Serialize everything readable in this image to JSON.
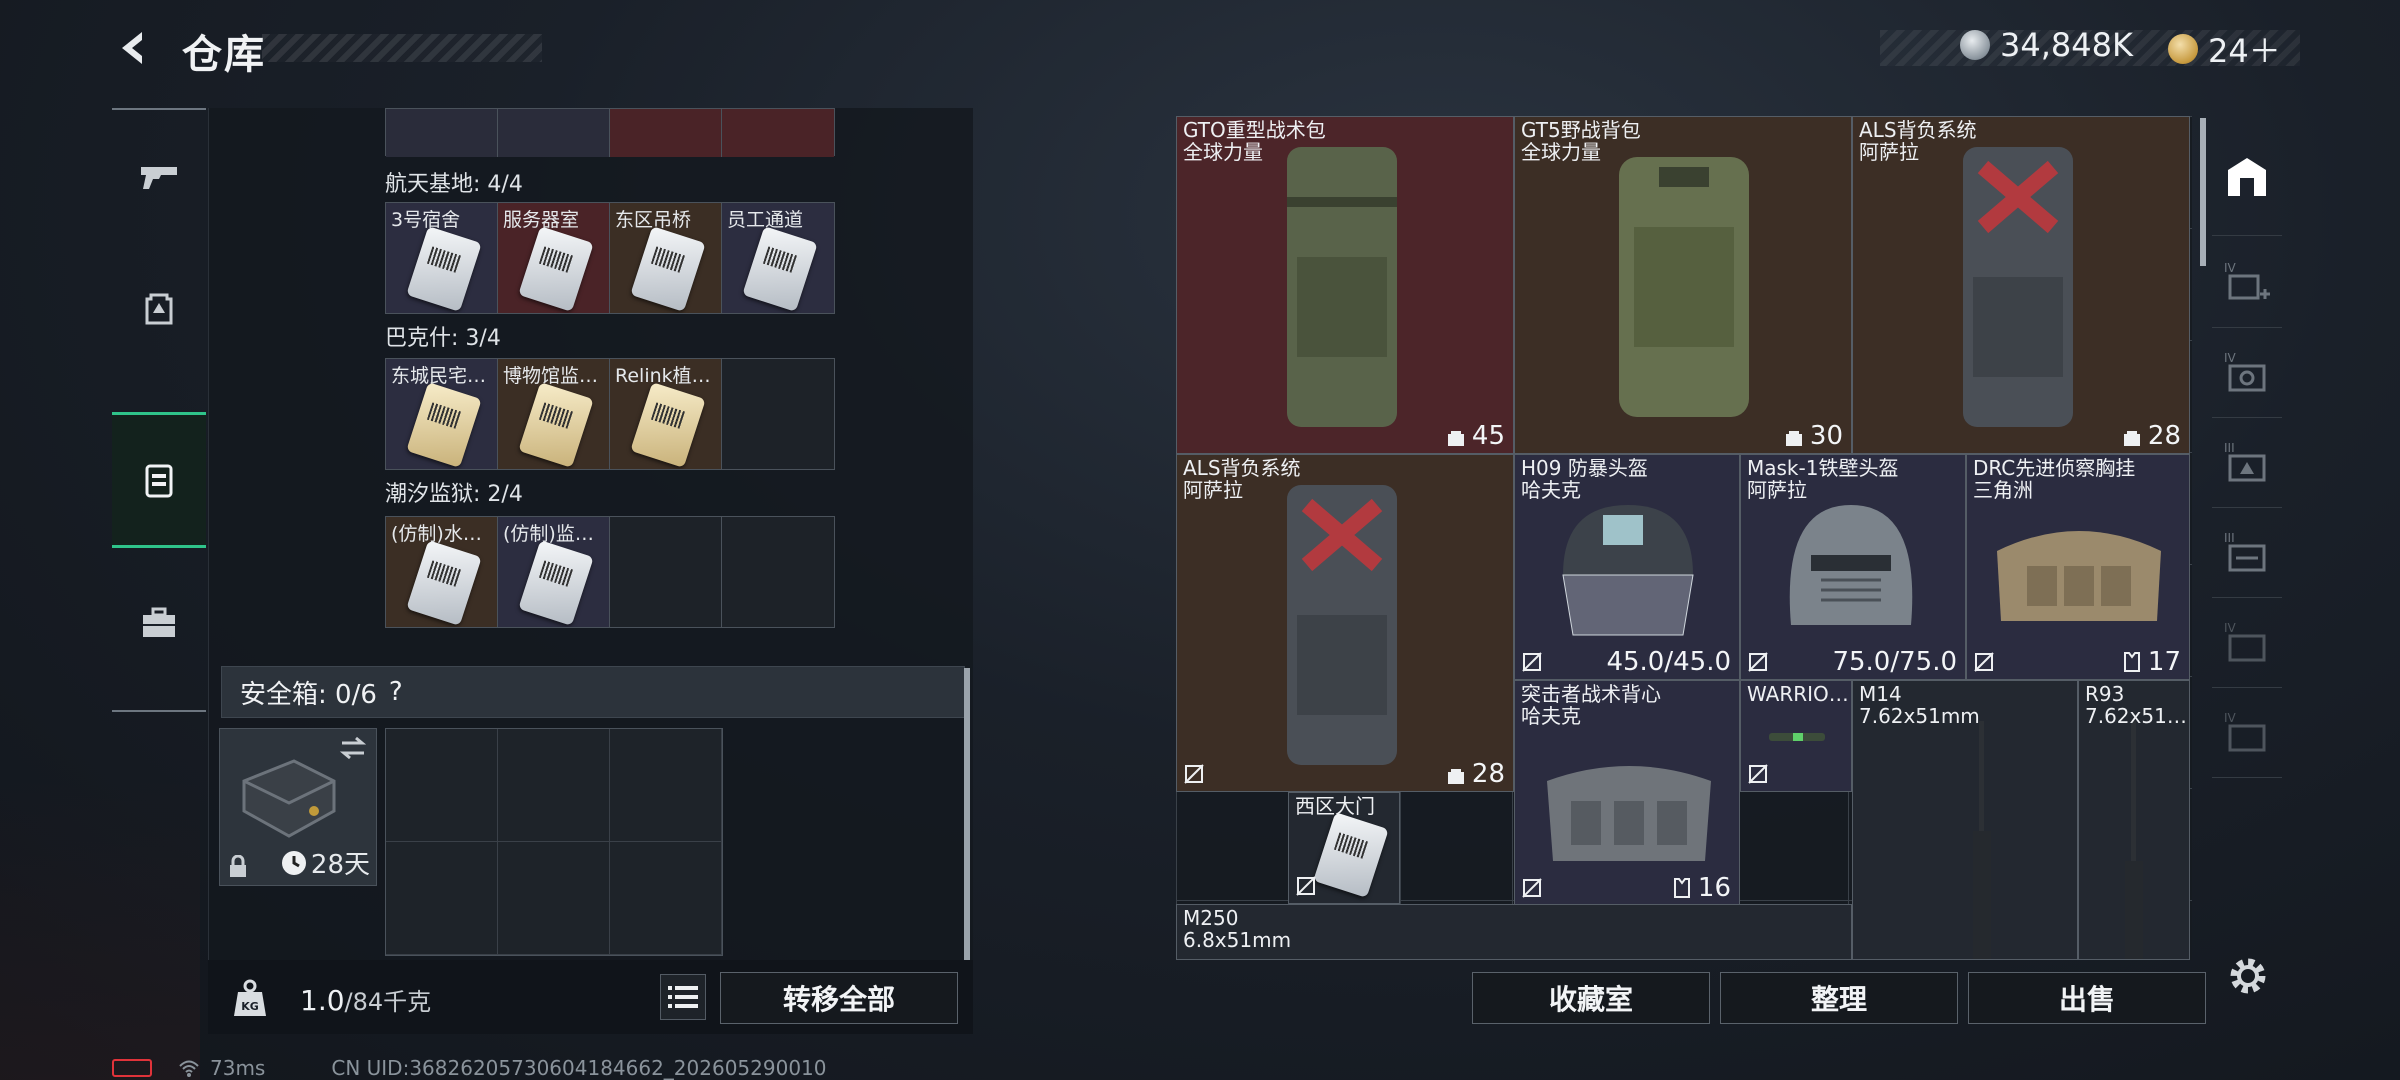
{
  "header": {
    "title": "仓库",
    "currency": [
      {
        "icon": "silver-coin-icon",
        "value": "34,848K"
      },
      {
        "icon": "gold-coin-icon",
        "value": "24＋"
      }
    ]
  },
  "warehouse": {
    "groups": [
      {
        "label": "航天基地: 4/4",
        "cells": [
          "3号宿舍",
          "服务器室",
          "东区吊桥",
          "员工通道"
        ]
      },
      {
        "label": "巴克什: 3/4",
        "cells": [
          "东城民宅…",
          "博物馆监…",
          "Relink植…",
          ""
        ]
      },
      {
        "label": "潮汐监狱: 2/4",
        "cells": [
          "(仿制)水…",
          "(仿制)监…",
          "",
          ""
        ]
      }
    ],
    "safe": {
      "label": "安全箱: 0/6",
      "help": "?",
      "timer": "28天"
    },
    "weight": {
      "current": "1.0",
      "max": "/84千克"
    },
    "transfer_all": "转移全部"
  },
  "stash": {
    "items": [
      {
        "name": "GTO重型战术包\n全球力量",
        "value": "45"
      },
      {
        "name": "GT5野战背包\n全球力量",
        "value": "30"
      },
      {
        "name": "ALS背负系统\n阿萨拉",
        "value": "28"
      },
      {
        "name": "ALS背负系统\n阿萨拉",
        "value": "28"
      },
      {
        "name": "H09 防暴头盔\n哈夫克",
        "value": "45.0/45.0"
      },
      {
        "name": "Mask-1铁壁头盔\n阿萨拉",
        "value": "75.0/75.0"
      },
      {
        "name": "DRC先进侦察胸挂\n三角洲",
        "value": "17"
      },
      {
        "name": "突击者战术背心\n哈夫克",
        "value": "16"
      },
      {
        "name": "WARRIO…",
        "value": ""
      },
      {
        "name": "M14\n7.62x51mm",
        "value": ""
      },
      {
        "name": "R93\n7.62x51…",
        "value": ""
      },
      {
        "name": "西区大门",
        "value": ""
      },
      {
        "name": "M250\n6.8x51mm",
        "value": ""
      }
    ],
    "buttons": {
      "collection": "收藏室",
      "organize": "整理",
      "sell": "出售"
    }
  },
  "status": {
    "ping": "73ms",
    "uid": "CN UID:3682620573060418466​2_202605290010"
  },
  "colors": {
    "accent": "#2fc48a",
    "rarity_red": "#4c2529",
    "rarity_brown": "#3c2e25",
    "rarity_purple": "#2b2c40"
  }
}
